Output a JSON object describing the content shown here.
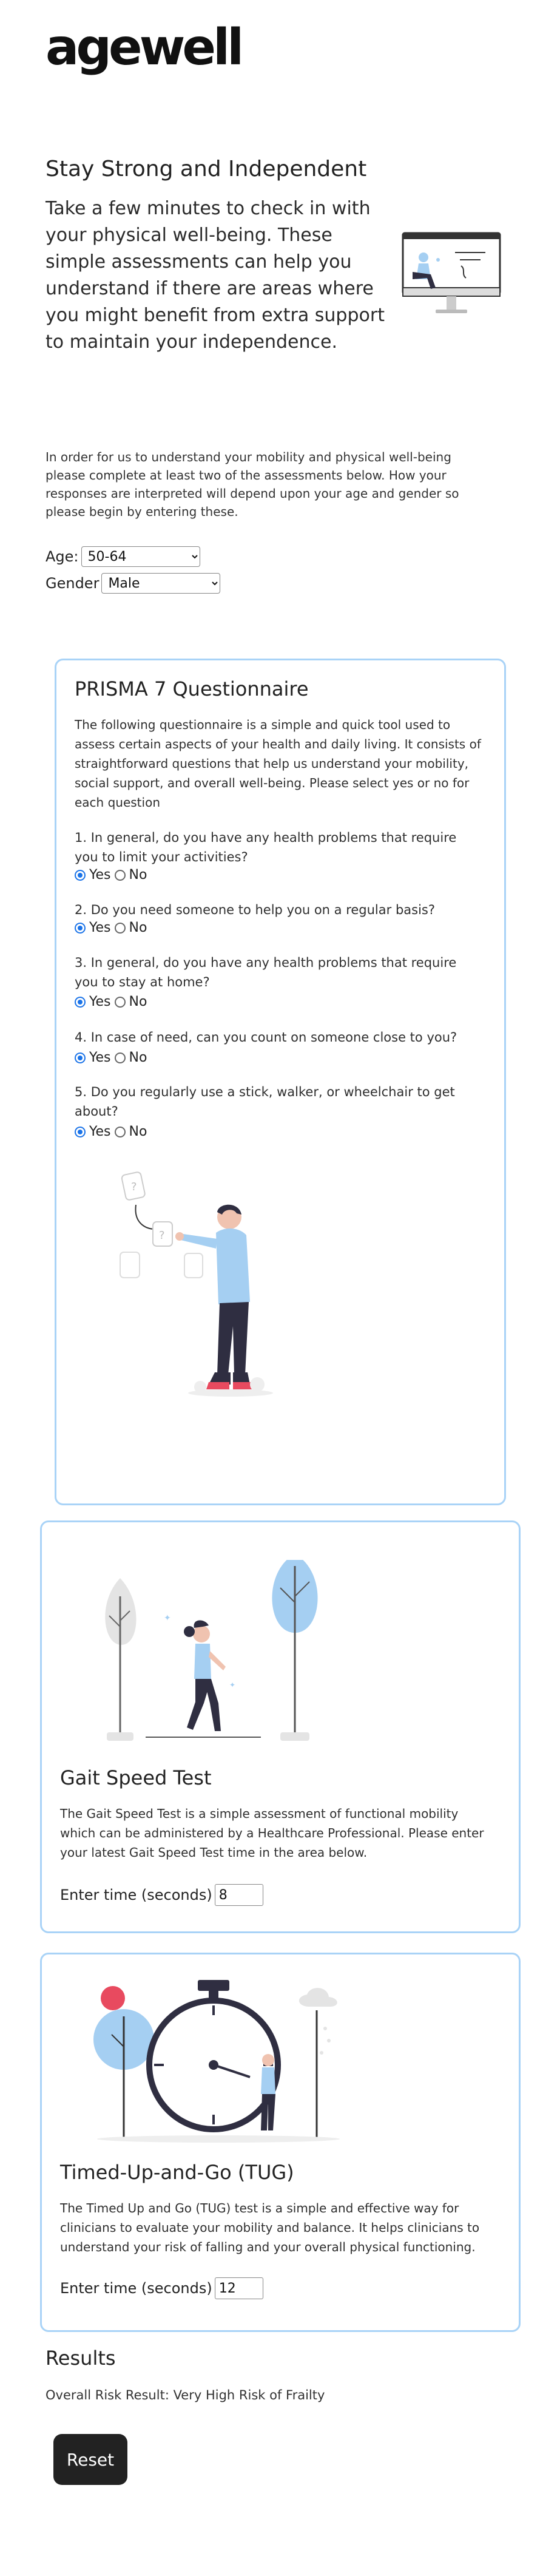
{
  "brand": {
    "logo_text": "agewell"
  },
  "hero": {
    "title": "Stay Strong and Independent",
    "lead": "Take a few minutes to check in with your physical well-being. These simple assessments can help you understand if there are areas where you might benefit from extra support to maintain your independence."
  },
  "intro": "In order for us to understand your mobility and physical well-being please complete at least two of the assessments below. How your responses are interpreted will depend upon your age and gender so please begin by entering these.",
  "demographics": {
    "age_label": "Age:",
    "age_value": "50-64",
    "gender_label": "Gender",
    "gender_value": "Male"
  },
  "prisma": {
    "title": "PRISMA 7 Questionnaire",
    "description": "The following questionnaire is a simple and quick tool used to assess certain aspects of your health and daily living. It consists of straightforward questions that help us understand your mobility, social support, and overall well-being. Please select yes or no for each question",
    "yes_label": "Yes",
    "no_label": "No",
    "questions": [
      {
        "text": "1. In general, do you have any health problems that require you to limit your activities?",
        "answer": "Yes"
      },
      {
        "text": "2. Do you need someone to help you on a regular basis?",
        "answer": "Yes"
      },
      {
        "text": "3. In general, do you have any health problems that require you to stay at home?",
        "answer": "Yes"
      },
      {
        "text": "4. In case of need, can you count on someone close to you?",
        "answer": "Yes"
      },
      {
        "text": "5. Do you regularly use a stick, walker, or wheelchair to get about?",
        "answer": "Yes"
      }
    ]
  },
  "gait": {
    "title": "Gait Speed Test",
    "description": "The Gait Speed Test is a simple assessment of functional mobility which can be administered by a Healthcare Professional. Please enter your latest Gait Speed Test time in the area below.",
    "input_label": "Enter time (seconds)",
    "input_value": "8"
  },
  "tug": {
    "title": "Timed-Up-and-Go (TUG)",
    "description": "The Timed Up and Go (TUG) test is a simple and effective way for clinicians to evaluate your mobility and balance. It helps clinicians to understand your risk of falling and your overall physical functioning.",
    "input_label": "Enter time (seconds)",
    "input_value": "12"
  },
  "results": {
    "title": "Results",
    "overall": "Overall Risk Result: Very High Risk of Frailty",
    "reset_label": "Reset"
  },
  "colors": {
    "accent_border": "#a9d3f7",
    "illustration_blue": "#a5cff2",
    "radio_blue": "#1a73e8",
    "button_dark": "#222222"
  }
}
